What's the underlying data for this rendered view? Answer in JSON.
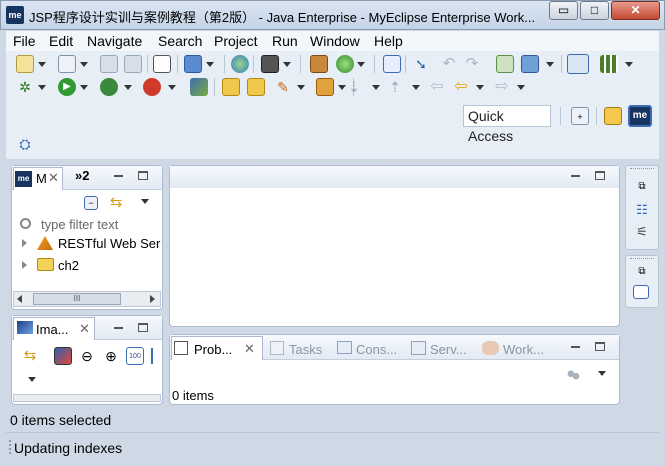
{
  "window": {
    "title": "JSP程序设计实训与案例教程（第2版） - Java Enterprise - MyEclipse Enterprise Work...",
    "minimize": "▭",
    "maximize": "□",
    "close": "✕"
  },
  "app_icon": "me",
  "menu": [
    "File",
    "Edit",
    "Navigate",
    "Search",
    "Project",
    "Run",
    "Window",
    "Help"
  ],
  "quick_access": "Quick Access",
  "explorer": {
    "tab_label": "M",
    "tab2_label": "»2",
    "filter_placeholder": "type filter text",
    "items": [
      {
        "label": "RESTful Web Ser",
        "icon": "rest-service-icon"
      },
      {
        "label": "ch2",
        "icon": "web-project-folder-icon"
      }
    ],
    "scroll_mark": "III"
  },
  "image_view": {
    "tab_label": "Ima..."
  },
  "bottom_tabs": [
    {
      "label": "Prob...",
      "icon": "problems-icon"
    },
    {
      "label": "Tasks",
      "icon": "tasks-icon"
    },
    {
      "label": "Cons...",
      "icon": "console-icon"
    },
    {
      "label": "Serv...",
      "icon": "servers-icon"
    },
    {
      "label": "Work...",
      "icon": "workspace-icon"
    }
  ],
  "problems": {
    "count_text": "0 items"
  },
  "status": {
    "selection": "0 items selected",
    "progress": "Updating indexes"
  },
  "colors": {
    "accent": "#17335f",
    "panel_border": "#aebad0",
    "window_bg": "#cfd9e6"
  }
}
